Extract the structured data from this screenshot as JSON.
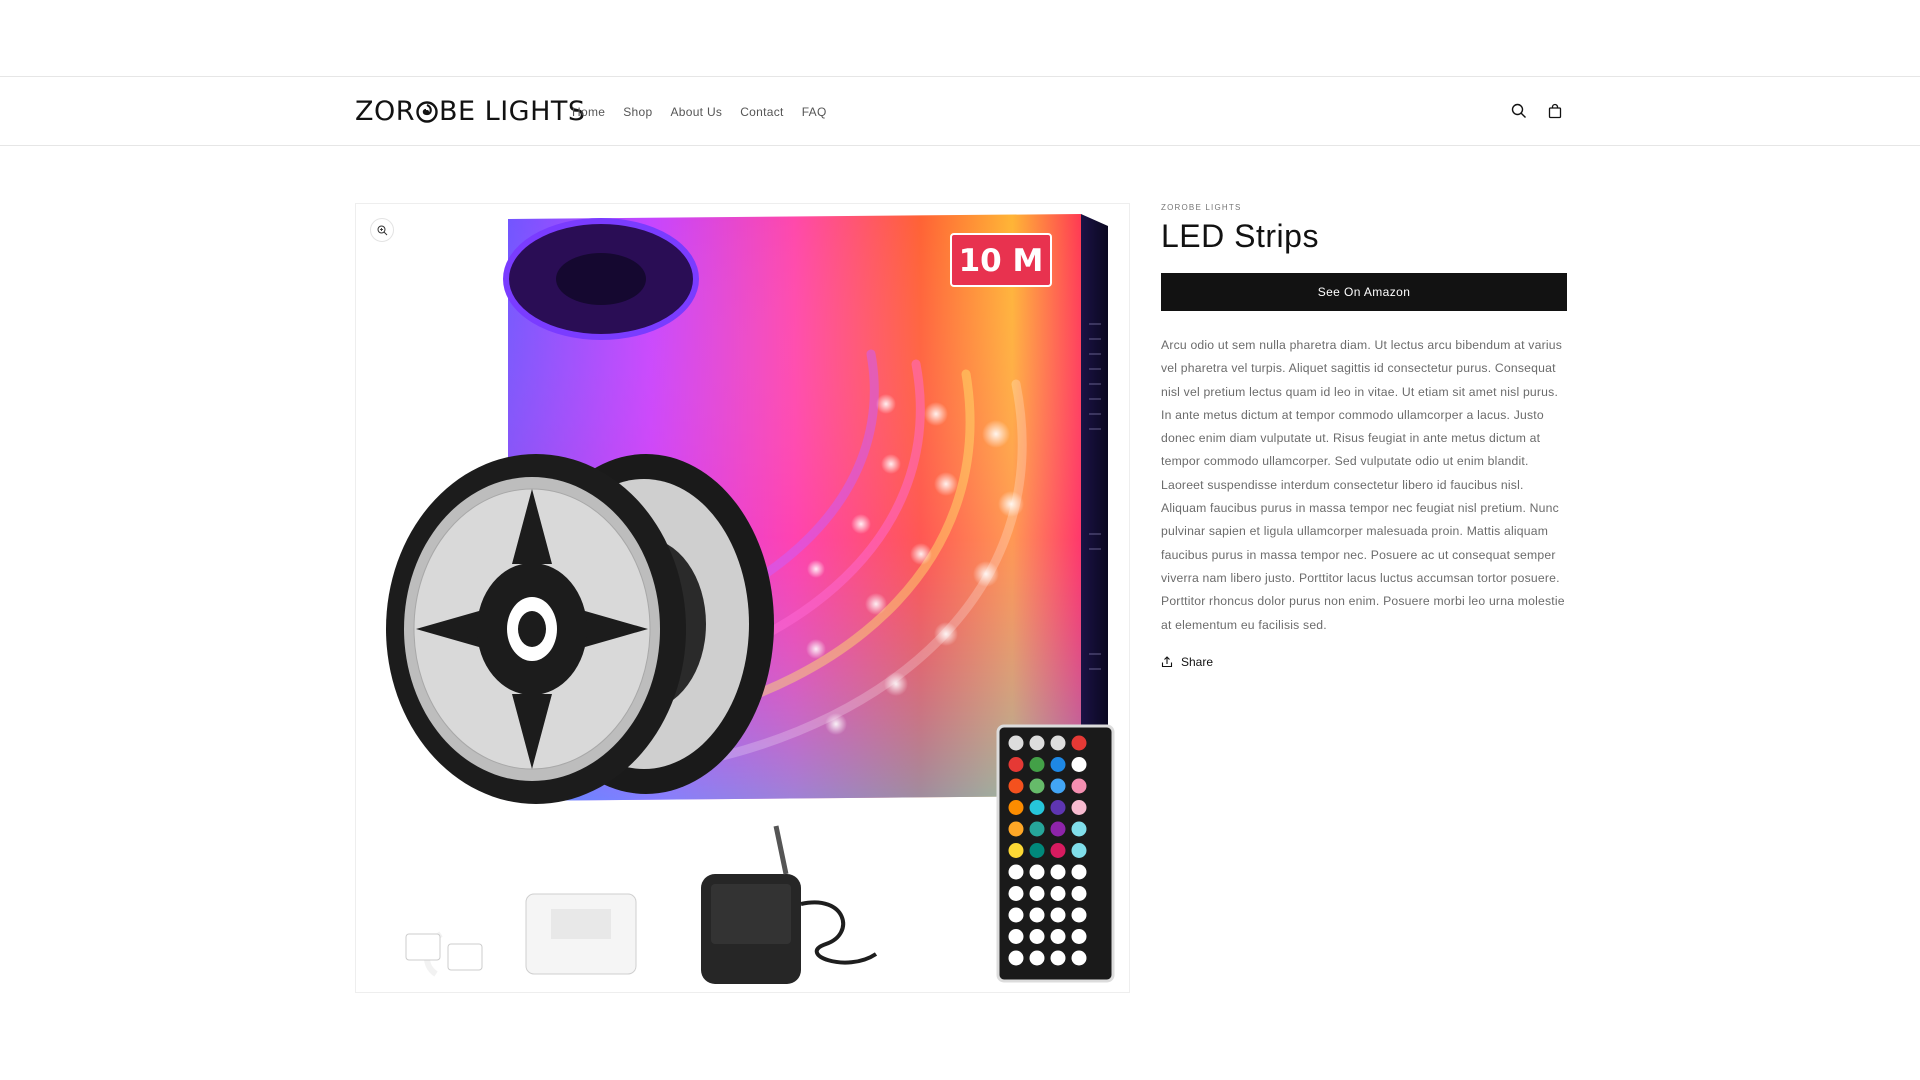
{
  "header": {
    "logo_text_left": "ZOR",
    "logo_text_right": "BE LIGHTS",
    "nav": [
      {
        "label": "Home"
      },
      {
        "label": "Shop"
      },
      {
        "label": "About Us"
      },
      {
        "label": "Contact"
      },
      {
        "label": "FAQ"
      }
    ],
    "icons": [
      "search-icon",
      "cart-icon"
    ]
  },
  "product": {
    "vendor": "ZOROBE LIGHTS",
    "title": "LED Strips",
    "cta_label": "See On Amazon",
    "description": "Arcu odio ut sem nulla pharetra diam. Ut lectus arcu bibendum at varius vel pharetra vel turpis. Aliquet sagittis id consectetur purus. Consequat nisl vel pretium lectus quam id leo in vitae. Ut etiam sit amet nisl purus. In ante metus dictum at tempor commodo ullamcorper a lacus. Justo donec enim diam vulputate ut. Risus feugiat in ante metus dictum at tempor commodo ullamcorper. Sed vulputate odio ut enim blandit. Laoreet suspendisse interdum consectetur libero id faucibus nisl. Aliquam faucibus purus in massa tempor nec feugiat nisl pretium. Nunc pulvinar sapien et ligula ullamcorper malesuada proin. Mattis aliquam faucibus purus in massa tempor nec. Posuere ac ut consequat semper viverra nam libero justo. Porttitor lacus luctus accumsan tortor posuere. Porttitor rhoncus dolor purus non enim. Posuere morbi leo urna molestie at elementum eu facilisis sed.",
    "share_label": "Share",
    "image": {
      "badge_text": "10 M",
      "icon": "zoom-icon"
    }
  },
  "colors": {
    "button_bg": "#121212",
    "badge_bg": "#e8324f"
  }
}
